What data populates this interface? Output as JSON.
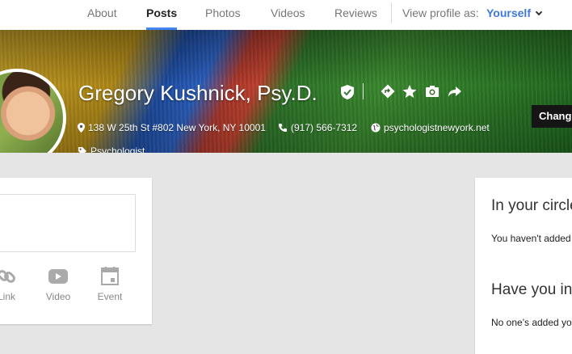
{
  "nav": {
    "tabs": [
      {
        "label": "About"
      },
      {
        "label": "Posts"
      },
      {
        "label": "Photos"
      },
      {
        "label": "Videos"
      },
      {
        "label": "Reviews"
      }
    ],
    "active_tab": "Posts",
    "view_as_label": "View profile as:",
    "view_as_value": "Yourself"
  },
  "profile": {
    "name": "Gregory Kushnick, Psy.D.",
    "address": "138 W 25th St #802 New York, NY 10001",
    "phone": "(917) 566-7312",
    "website": "psychologistnewyork.net",
    "category": "Psychologist",
    "change_button": "Change cover"
  },
  "share": {
    "items": [
      {
        "label": "Link",
        "icon": "link-icon"
      },
      {
        "label": "Video",
        "icon": "video-icon"
      },
      {
        "label": "Event",
        "icon": "event-icon"
      }
    ]
  },
  "right_panel": {
    "circles_heading": "In your circles",
    "circles_text": "You haven't added anyone yet.",
    "have_you_heading": "Have you in circles",
    "have_you_text": "No one's added you yet."
  },
  "colors": {
    "accent": "#4285f4",
    "link": "#3f79d6",
    "background": "#e5e5e5"
  }
}
